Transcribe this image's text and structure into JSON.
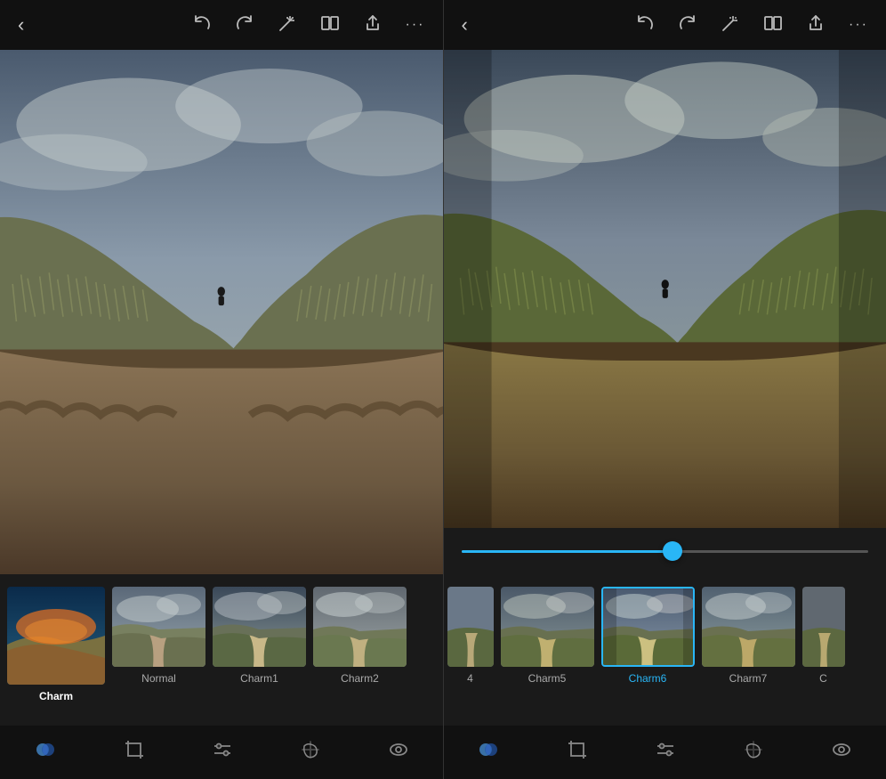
{
  "left_panel": {
    "toolbar": {
      "back_label": "‹",
      "undo_label": "↩",
      "redo_label": "↪",
      "magic_label": "✦",
      "compare_label": "⧉",
      "share_label": "⬆",
      "more_label": "•••"
    },
    "filters": [
      {
        "id": "charm",
        "label": "Charm",
        "selected": true,
        "large": true
      },
      {
        "id": "normal",
        "label": "Normal",
        "selected": false,
        "large": false
      },
      {
        "id": "charm1",
        "label": "Charm1",
        "selected": false,
        "large": false
      },
      {
        "id": "charm2",
        "label": "Charm2",
        "selected": false,
        "large": false
      }
    ],
    "nav": {
      "filters_active": true
    }
  },
  "right_panel": {
    "toolbar": {
      "back_label": "‹",
      "undo_label": "↩",
      "redo_label": "↪",
      "magic_label": "✦",
      "compare_label": "⧉",
      "share_label": "⬆",
      "more_label": "•••"
    },
    "slider": {
      "value": 52,
      "min": 0,
      "max": 100
    },
    "filters": [
      {
        "id": "charm4",
        "label": "4",
        "selected": false,
        "partial": true
      },
      {
        "id": "charm5",
        "label": "Charm5",
        "selected": false,
        "large": false
      },
      {
        "id": "charm6",
        "label": "Charm6",
        "selected": true,
        "large": false
      },
      {
        "id": "charm7",
        "label": "Charm7",
        "selected": false,
        "large": false
      },
      {
        "id": "charmC",
        "label": "C",
        "selected": false,
        "partial": true
      }
    ]
  },
  "colors": {
    "accent": "#29b6f6",
    "toolbar_bg": "#111111",
    "panel_bg": "#1a1a1a",
    "icon_normal": "#cccccc",
    "label_selected": "#29b6f6",
    "label_normal": "#aaaaaa"
  }
}
